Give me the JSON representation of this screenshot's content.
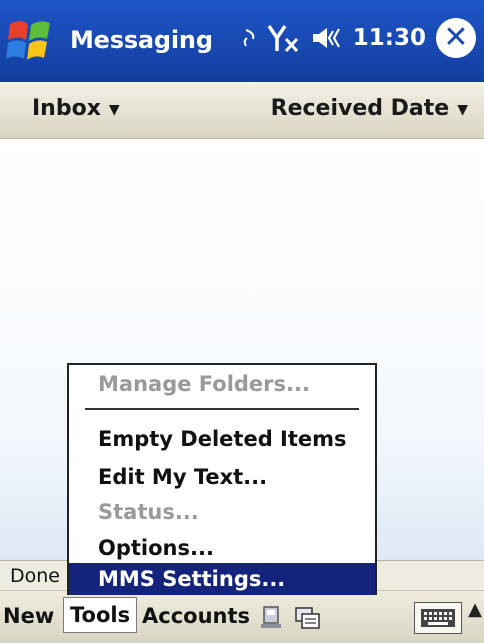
{
  "title_bar": {
    "app_title": "Messaging",
    "time": "11:30"
  },
  "header": {
    "folder_label": "Inbox",
    "sort_label": "Received Date"
  },
  "status_bar": {
    "text": "Done"
  },
  "menu_bar": {
    "new": "New",
    "tools": "Tools",
    "accounts": "Accounts"
  },
  "tools_menu": {
    "manage_folders": "Manage Folders...",
    "empty_deleted": "Empty Deleted Items",
    "edit_text": "Edit My Text...",
    "status": "Status...",
    "options": "Options...",
    "mms_settings": "MMS Settings..."
  },
  "colors": {
    "title_blue": "#1f55c8",
    "menu_highlight": "#14247c",
    "disabled_gray": "#9a9a9a"
  },
  "icons": [
    "windows-start-icon",
    "sync-icon",
    "signal-off-icon",
    "volume-icon",
    "close-icon",
    "send-receive-icon",
    "folder-icon",
    "keyboard-icon",
    "up-arrow-icon"
  ]
}
